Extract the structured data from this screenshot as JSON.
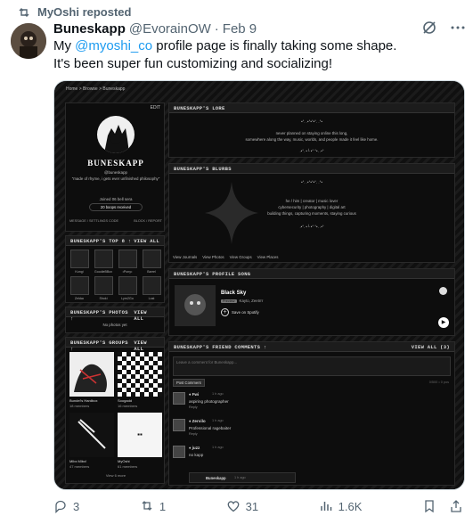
{
  "repost": {
    "text": "MyOshi reposted"
  },
  "tweet": {
    "display_name": "Buneskapp",
    "handle": "@EvorainOW",
    "date": "Feb 9",
    "text_pre": "My ",
    "mention": "@myoshi_co",
    "text_post": " profile page is finally taking some shape.",
    "text_line2": "It's been super fun customizing and socializing!"
  },
  "screenshot": {
    "breadcrumb": "Home > Browse > Buneskapp",
    "profile": {
      "edit_label": "EDIT",
      "name": "BUNESKAPP",
      "handle": "@buneskapp",
      "tagline": "\"made of rhyme, i gets ever unfinished philosophy\"",
      "joined": "Joined 06 bell sera",
      "badge": "20 boops received",
      "footer_left": "MESSAGE / SETTLINGS CODE",
      "footer_right": "BLOCK / REPORT"
    },
    "lore": {
      "title": "BUNESKAPP'S LORE",
      "line1": "never planned on staying online this long,",
      "line2": "somewhere along the way, music, worlds, and people made it feel like home.",
      "deco_top": "•°. .•°•°•°. .°•",
      "deco_bottom": ".•°. •╰ •° °•. .•°"
    },
    "blurbs": {
      "title": "BUNESKAPP'S BLURBS",
      "line1": "he / him | creator | music lover",
      "line2": "cybersecurity | photography | digital art",
      "line3": "building things, capturing moments, staying curious",
      "deco_top": "•°. .•°•°•°. .°•",
      "deco_bottom": ".•°. •╰ •° °•. .•°",
      "links": [
        "View Journals",
        "View Photos",
        "View Groups",
        "View Places"
      ]
    },
    "top8": {
      "title": "BUNESKAPP'S TOP 8 ↑",
      "view_all": "VIEW ALL",
      "names": [
        "Kongi",
        "GoodieBBox",
        "•Pony•",
        "Barrel",
        "Zelda•",
        "Shoki",
        "Lyrn2Go",
        "Lost"
      ]
    },
    "photos": {
      "title": "BUNESKAPP'S PHOTOS ↑",
      "view_all": "VIEW ALL",
      "empty": "No photos yet"
    },
    "groups": {
      "title": "BUNESKAPP'S GROUPS ↑",
      "view_all": "VIEW ALL",
      "items": [
        {
          "name": "Bundel's Hardbox",
          "members": "18 members"
        },
        {
          "name": "Soogadd",
          "members": "16 members"
        },
        {
          "name": "Mlbx Mlbx!",
          "members": "47 members"
        },
        {
          "name": "MyOshi",
          "members": "61 members"
        }
      ],
      "more": "View 6 more"
    },
    "song": {
      "title": "BUNESKAPP'S PROFILE SONG",
      "track": "Black Sky",
      "preview_label": "Preview",
      "artist": "Kayto, Zeetrrr",
      "save_label": "Save on Spotify",
      "play_label": "▶"
    },
    "comments": {
      "title": "BUNESKAPP'S FRIEND COMMENTS ↑",
      "view_all": "VIEW ALL (3)",
      "placeholder": "Leave a comment for Buneskapp...",
      "post_label": "Post Comment",
      "counter": "0/500 • 0 pos",
      "items": [
        {
          "user": "♦ Fwi",
          "time": "1 h ago",
          "text": "aspiring photographer",
          "reply": "Reply"
        },
        {
          "user": "♦ Zervilo",
          "time": "1 h ago",
          "text": "Professional ragebaiter",
          "reply": "Reply"
        },
        {
          "user": "♦ juzz",
          "time": "1 h ago",
          "text": "no kapp",
          "reply": ""
        }
      ],
      "sub_reply_user": "Buneskapp",
      "sub_reply_time": "1 h ago"
    }
  },
  "actions": {
    "replies": "3",
    "reposts": "1",
    "likes": "31",
    "views": "1.6K"
  }
}
